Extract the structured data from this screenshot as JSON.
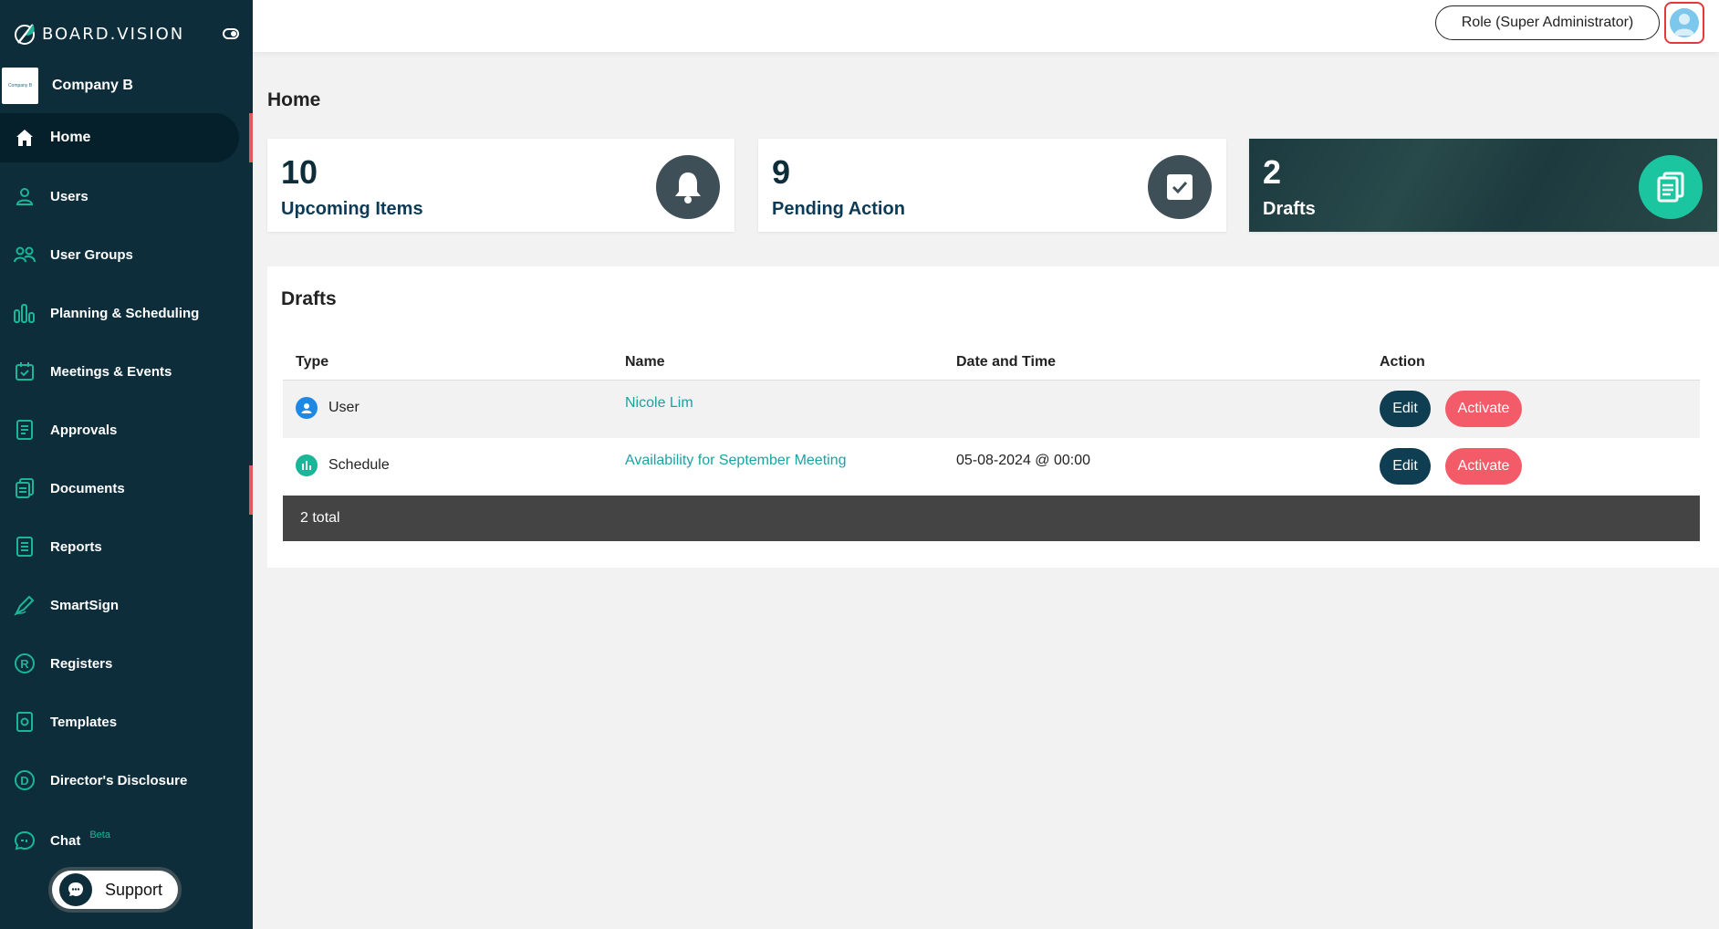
{
  "brand": {
    "name": "BOARD.VISION",
    "logo_icon": "leaf-feather-icon"
  },
  "company": {
    "name": "Company B",
    "logo_text": "Company B"
  },
  "topbar": {
    "role_label": "Role (Super Administrator)",
    "avatar_icon": "user-avatar-icon"
  },
  "sidebar": {
    "items": [
      {
        "label": "Home",
        "icon": "home-icon",
        "active": true
      },
      {
        "label": "Users",
        "icon": "user-icon"
      },
      {
        "label": "User Groups",
        "icon": "user-group-icon"
      },
      {
        "label": "Planning & Scheduling",
        "icon": "bar-chart-icon"
      },
      {
        "label": "Meetings & Events",
        "icon": "calendar-check-icon"
      },
      {
        "label": "Approvals",
        "icon": "approval-document-icon"
      },
      {
        "label": "Documents",
        "icon": "documents-icon"
      },
      {
        "label": "Reports",
        "icon": "report-list-icon"
      },
      {
        "label": "SmartSign",
        "icon": "pen-icon"
      },
      {
        "label": "Registers",
        "icon": "registered-r-icon"
      },
      {
        "label": "Templates",
        "icon": "template-icon"
      },
      {
        "label": "Director's Disclosure",
        "icon": "disclosure-d-icon"
      },
      {
        "label": "Chat",
        "icon": "chat-bubble-icon",
        "badge": "Beta"
      }
    ],
    "support_label": "Support"
  },
  "page": {
    "title": "Home"
  },
  "cards": [
    {
      "count": "10",
      "label": "Upcoming Items",
      "icon": "bell-icon"
    },
    {
      "count": "9",
      "label": "Pending Action",
      "icon": "checkbox-icon"
    },
    {
      "count": "2",
      "label": "Drafts",
      "icon": "drafts-icon"
    }
  ],
  "drafts": {
    "title": "Drafts",
    "columns": [
      "Type",
      "Name",
      "Date and Time",
      "Action"
    ],
    "rows": [
      {
        "type": "User",
        "type_icon": "user-circle-icon",
        "name": "Nicole Lim",
        "datetime": "",
        "edit": "Edit",
        "activate": "Activate"
      },
      {
        "type": "Schedule",
        "type_icon": "schedule-chart-icon",
        "name": "Availability for September Meeting",
        "datetime": "05-08-2024 @ 00:00",
        "edit": "Edit",
        "activate": "Activate"
      }
    ],
    "total": "2 total"
  },
  "colors": {
    "sidebar": "#0d2d3b",
    "accent_teal": "#1bb59a",
    "activate": "#f45b69",
    "edit": "#0f3d52",
    "active_marker": "#e05a5a"
  }
}
